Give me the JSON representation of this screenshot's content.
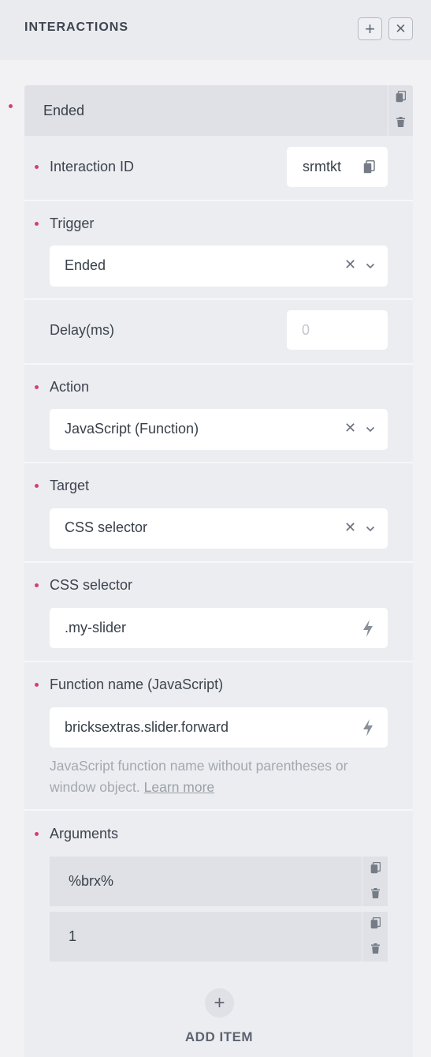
{
  "header": {
    "title": "INTERACTIONS",
    "add_icon": "plus-icon",
    "close_icon": "close-icon"
  },
  "item": {
    "title": "Ended",
    "copy_icon": "copy-icon",
    "delete_icon": "trash-icon"
  },
  "fields": {
    "interaction_id": {
      "label": "Interaction ID",
      "value": "srmtkt",
      "icon": "copy-icon"
    },
    "trigger": {
      "label": "Trigger",
      "value": "Ended"
    },
    "delay": {
      "label": "Delay(ms)",
      "placeholder": "0"
    },
    "action": {
      "label": "Action",
      "value": "JavaScript (Function)"
    },
    "target": {
      "label": "Target",
      "value": "CSS selector"
    },
    "css_selector": {
      "label": "CSS selector",
      "value": ".my-slider",
      "icon": "bolt-icon"
    },
    "function_name": {
      "label": "Function name (JavaScript)",
      "value": "bricksextras.slider.forward",
      "icon": "bolt-icon",
      "help": "JavaScript function name without parentheses or window object.",
      "help_link": "Learn more"
    },
    "arguments": {
      "label": "Arguments",
      "items": [
        {
          "value": "%brx%"
        },
        {
          "value": "1"
        }
      ],
      "add_label": "ADD ITEM"
    }
  },
  "colors": {
    "accent_bullet": "#d63d7a",
    "panel_bg": "#ecedf1",
    "input_bg": "#ffffff"
  }
}
